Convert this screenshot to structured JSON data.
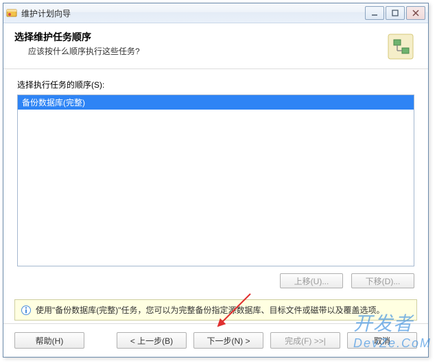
{
  "window": {
    "title": "维护计划向导"
  },
  "header": {
    "title": "选择维护任务顺序",
    "subtitle": "应该按什么顺序执行这些任务?"
  },
  "list_label": "选择执行任务的顺序(S):",
  "tasks": [
    "备份数据库(完整)"
  ],
  "buttons": {
    "move_up": "上移(U)...",
    "move_down": "下移(D)...",
    "help": "帮助(H)",
    "back": "< 上一步(B)",
    "next": "下一步(N) >",
    "finish": "完成(F) >>|",
    "cancel": "取消"
  },
  "info_text": "使用\"备份数据库(完整)\"任务，您可以为完整备份指定源数据库、目标文件或磁带以及覆盖选项。",
  "watermark": {
    "line1": "开发者",
    "line2": "DevZe.CoM"
  }
}
